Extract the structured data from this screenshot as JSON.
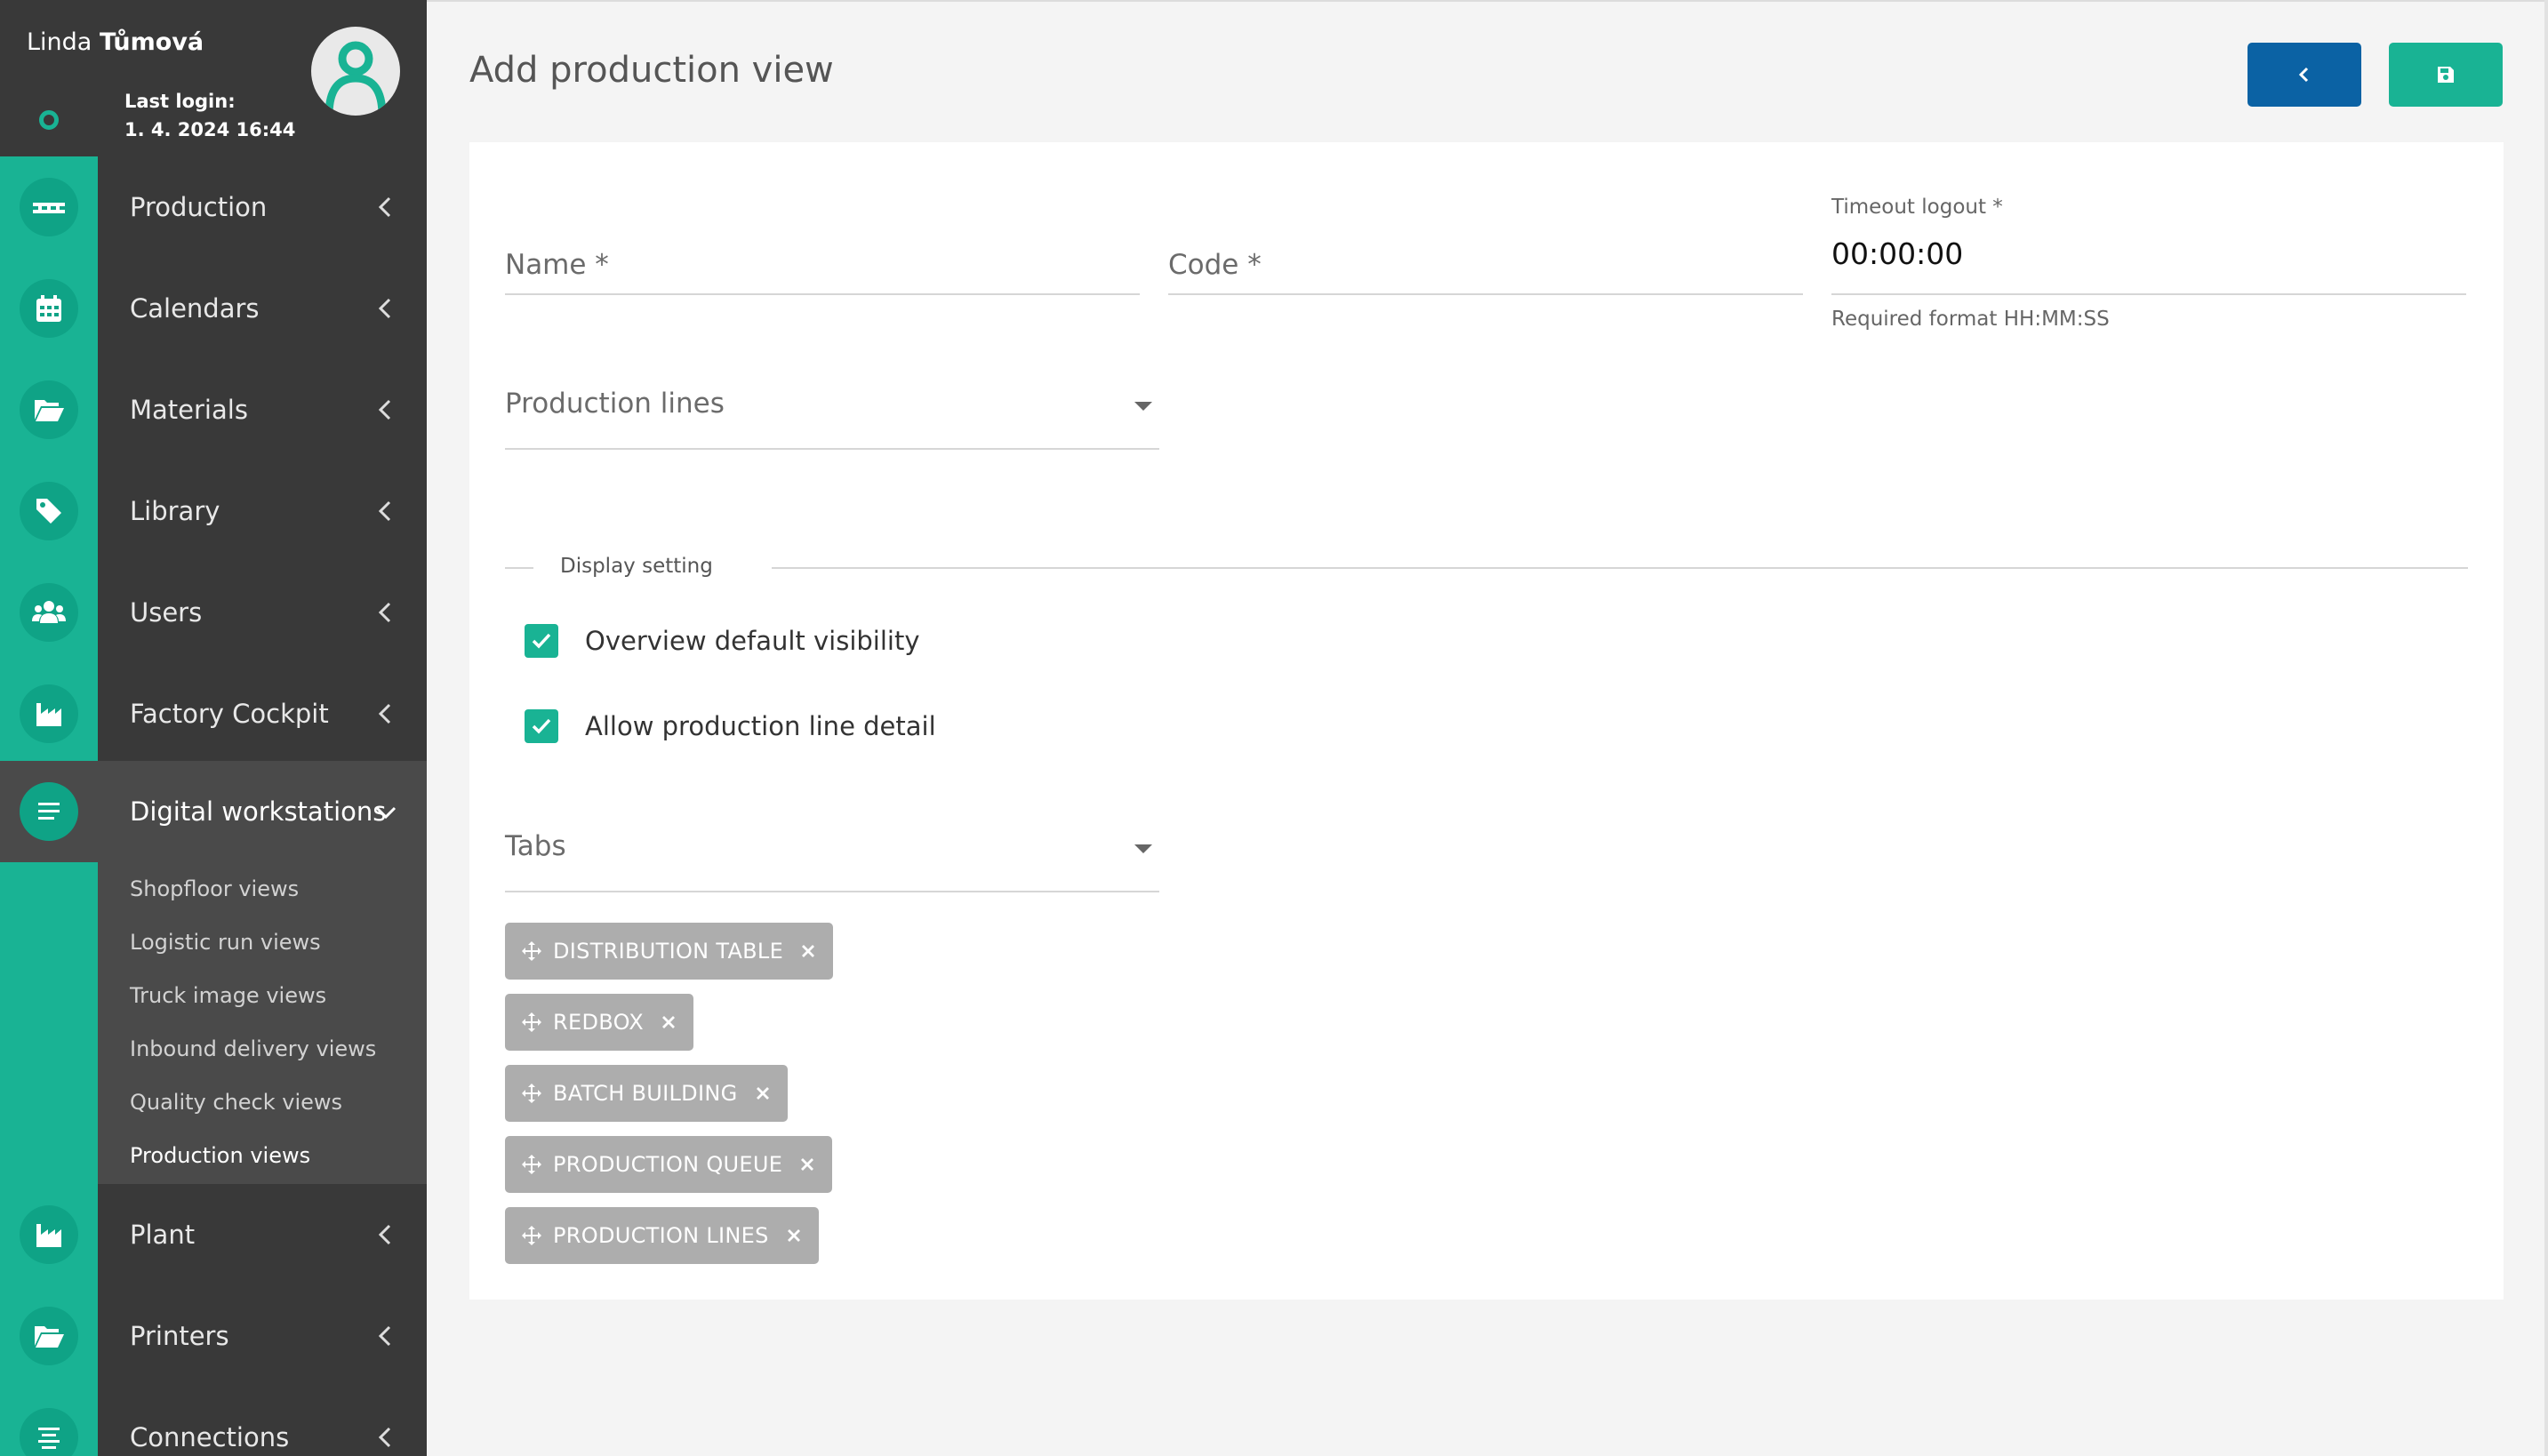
{
  "user": {
    "first_name": "Linda",
    "last_name": "Tůmová",
    "last_login_label": "Last login:",
    "last_login_value": "1. 4. 2024 16:44"
  },
  "sidebar": {
    "items": [
      {
        "label": "Production",
        "icon": "conveyor-icon"
      },
      {
        "label": "Calendars",
        "icon": "calendar-icon"
      },
      {
        "label": "Materials",
        "icon": "folder-open-icon"
      },
      {
        "label": "Library",
        "icon": "tags-icon"
      },
      {
        "label": "Users",
        "icon": "users-icon"
      },
      {
        "label": "Factory Cockpit",
        "icon": "factory-icon"
      },
      {
        "label": "Digital workstations",
        "icon": "list-icon"
      },
      {
        "label": "Plant",
        "icon": "factory-icon"
      },
      {
        "label": "Printers",
        "icon": "folder-open-icon"
      },
      {
        "label": "Connections",
        "icon": "align-center-icon"
      }
    ],
    "submenu": [
      "Shopfloor views",
      "Logistic run views",
      "Truck image views",
      "Inbound delivery views",
      "Quality check views",
      "Production views"
    ],
    "active_submenu": "Production views"
  },
  "page": {
    "title": "Add production view"
  },
  "form": {
    "name_placeholder": "Name *",
    "code_placeholder": "Code *",
    "timeout_label": "Timeout logout *",
    "timeout_value": "00:00:00",
    "timeout_hint": "Required format HH:MM:SS",
    "production_lines_placeholder": "Production lines",
    "display_setting_title": "Display setting",
    "checkboxes": [
      {
        "label": "Overview default visibility",
        "checked": true
      },
      {
        "label": "Allow production line detail",
        "checked": true
      }
    ],
    "tabs_placeholder": "Tabs",
    "tabs": [
      "DISTRIBUTION TABLE",
      "REDBOX",
      "BATCH BUILDING",
      "PRODUCTION QUEUE",
      "PRODUCTION LINES"
    ]
  },
  "colors": {
    "accent": "#19b394",
    "back_button": "#0b62a4",
    "sidebar": "#393939",
    "chip": "#adadad"
  }
}
